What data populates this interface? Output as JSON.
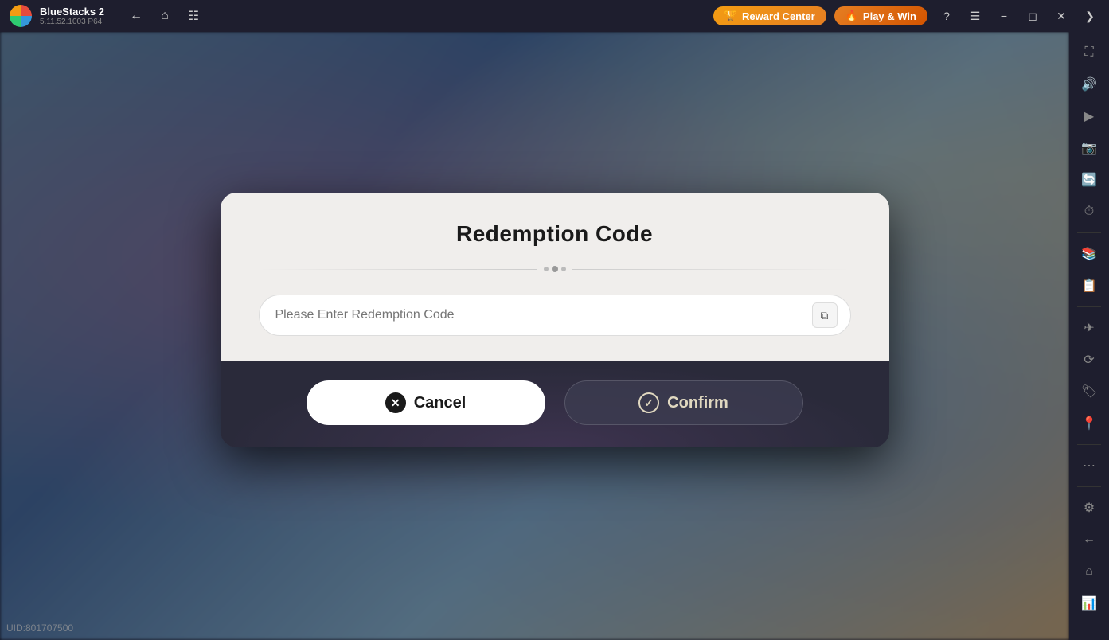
{
  "titlebar": {
    "app_name": "BlueStacks 2",
    "version": "5.11.52.1003  P64",
    "reward_center_label": "Reward Center",
    "play_win_label": "Play & Win"
  },
  "uid": {
    "label": "UID:801707500"
  },
  "dialog": {
    "title": "Redemption Code",
    "input_placeholder": "Please Enter Redemption Code",
    "cancel_label": "Cancel",
    "confirm_label": "Confirm"
  },
  "sidebar": {
    "icons": [
      "⛶",
      "🔊",
      "▶",
      "📷",
      "🔄",
      "⏱",
      "📚",
      "📋",
      "✈",
      "⟳",
      "🏷",
      "📍",
      "⋯",
      "⚙",
      "←",
      "🏠",
      "📊"
    ]
  }
}
